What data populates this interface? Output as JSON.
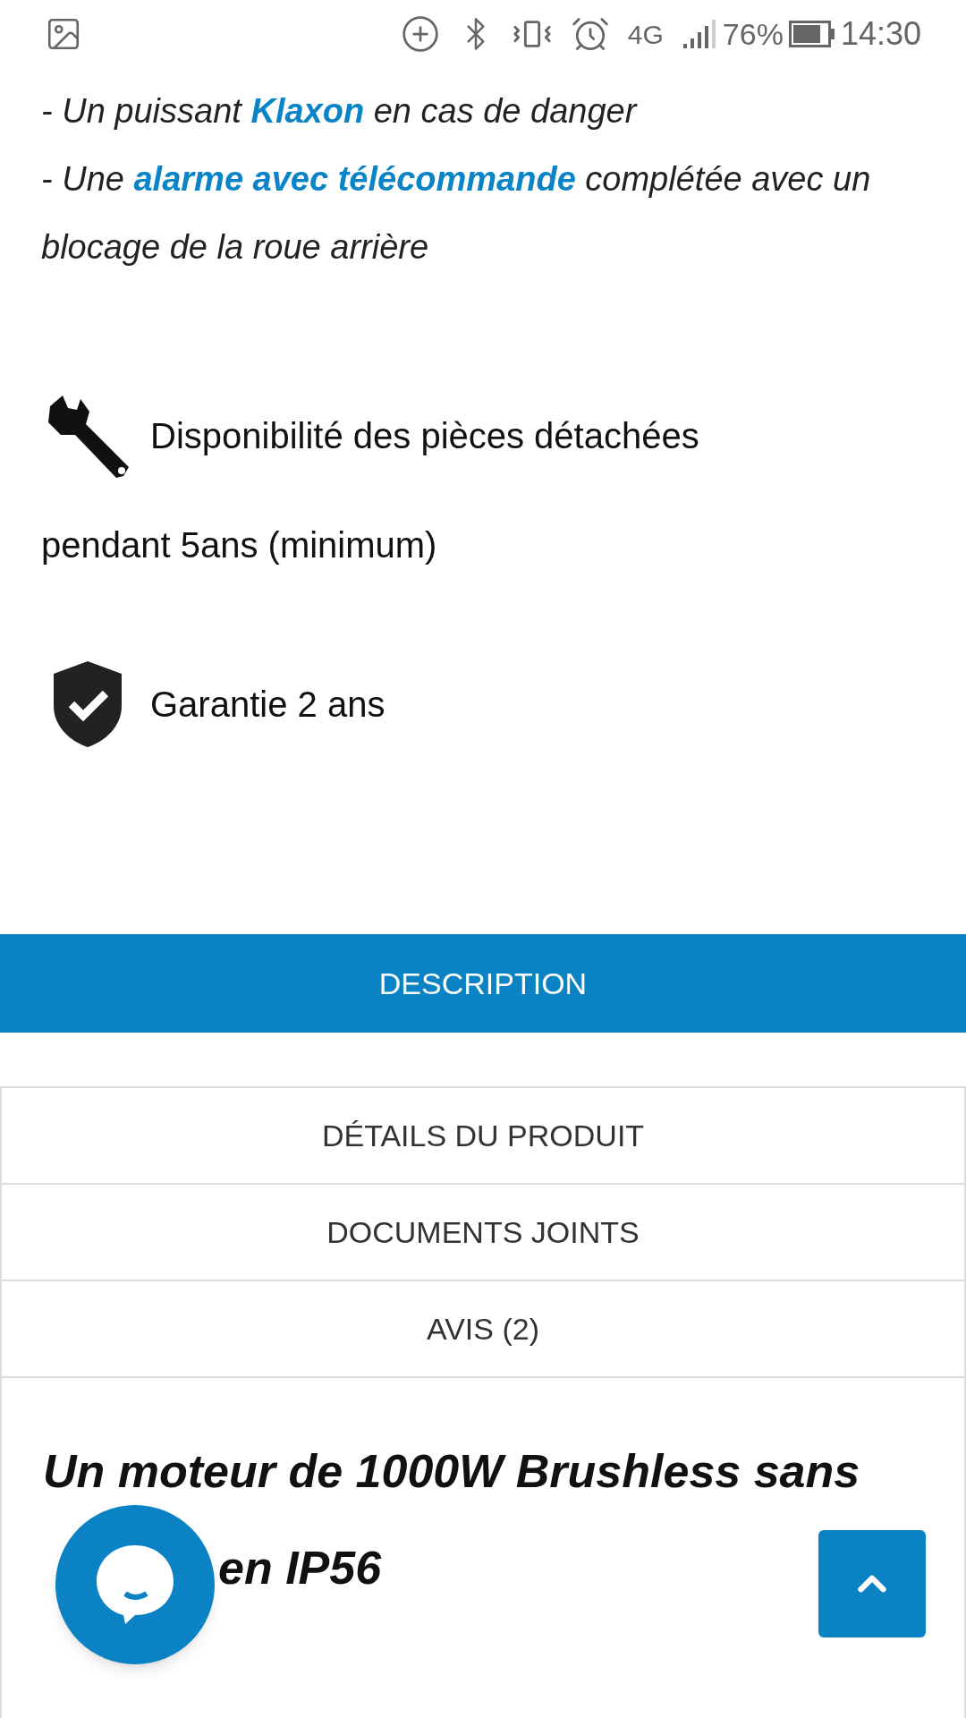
{
  "status_bar": {
    "network": "4G",
    "battery": "76%",
    "time": "14:30"
  },
  "paragraphs": [
    "- Un puissant **Klaxon** en cas de danger",
    "- Une **alarme avec télécommande** complétée avec un blocage de la roue arrière"
  ],
  "features": [
    {
      "kind": "wrench",
      "lines": [
        "Disponibilité des pièces détachées",
        "pendant 5ans (minimum)"
      ]
    },
    {
      "kind": "shield",
      "lines": [
        "Garantie 2 ans"
      ]
    }
  ],
  "tabs": [
    {
      "label": "DESCRIPTION",
      "selected": true
    },
    {
      "label": "DÉTAILS DU PRODUIT",
      "selected": false
    },
    {
      "label": "DOCUMENTS JOINTS",
      "selected": false
    },
    {
      "label": "AVIS (2)",
      "selected": false
    }
  ],
  "heading": {
    "line_1": "Un moteur de 1000W Brushless sans",
    "line_2_end": "en IP56"
  }
}
